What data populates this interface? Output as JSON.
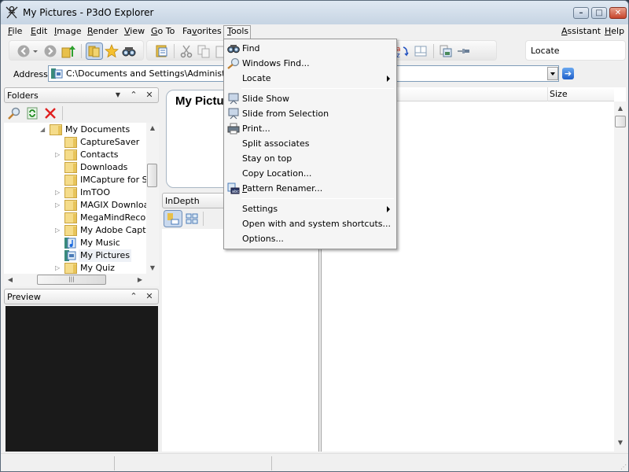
{
  "window": {
    "title": "My Pictures - P3dO Explorer",
    "controls": {
      "minimize": "–",
      "maximize": "□",
      "close": "✕"
    }
  },
  "menubar": {
    "items": [
      {
        "label": "File",
        "accel": "F",
        "rest": "ile"
      },
      {
        "label": "Edit",
        "accel": "E",
        "rest": "dit"
      },
      {
        "label": "Image",
        "accel": "I",
        "rest": "mage"
      },
      {
        "label": "Render",
        "accel": "R",
        "rest": "ender"
      },
      {
        "label": "View",
        "accel": "V",
        "rest": "iew"
      },
      {
        "label": "Go To",
        "accel": "G",
        "rest": "o To"
      },
      {
        "label": "Favorites",
        "pre": "Fa",
        "accel": "v",
        "rest": "orites"
      },
      {
        "label": "Tools",
        "accel": "T",
        "rest": "ools"
      }
    ],
    "right_items": [
      {
        "label": "Assistant",
        "accel": "A",
        "rest": "ssistant"
      },
      {
        "label": "Help",
        "accel": "H",
        "rest": "elp"
      }
    ]
  },
  "toolbar": {
    "icons": [
      "back-icon",
      "back-dropdown-icon",
      "forward-icon",
      "up-folder-icon",
      "folders-toggle-icon",
      "favorites-star-icon",
      "find-binoculars-icon",
      "folder-view-icon",
      "cut-icon",
      "copy-icon",
      "paste-icon",
      "sort-az-icon",
      "layout-icon",
      "copy-image-icon",
      "pin-icon"
    ],
    "locate_label": "Locate"
  },
  "address": {
    "label": "Address",
    "value": "C:\\Documents and Settings\\Administrator"
  },
  "folders_pane": {
    "title": "Folders",
    "tree": [
      {
        "label": "My Documents",
        "expander": "expanded",
        "icon": "folder",
        "level": 0
      },
      {
        "label": "CaptureSaver",
        "expander": "none",
        "icon": "folder",
        "level": 1
      },
      {
        "label": "Contacts",
        "expander": "collapsed",
        "icon": "folder",
        "level": 1
      },
      {
        "label": "Downloads",
        "expander": "none",
        "icon": "folder",
        "level": 1
      },
      {
        "label": "IMCapture for Sk",
        "expander": "none",
        "icon": "folder",
        "level": 1
      },
      {
        "label": "ImTOO",
        "expander": "collapsed",
        "icon": "folder",
        "level": 1
      },
      {
        "label": "MAGIX Download",
        "expander": "collapsed",
        "icon": "folder",
        "level": 1
      },
      {
        "label": "MegaMindRecord",
        "expander": "none",
        "icon": "folder",
        "level": 1
      },
      {
        "label": "My Adobe Captiv",
        "expander": "collapsed",
        "icon": "folder",
        "level": 1
      },
      {
        "label": "My Music",
        "expander": "none",
        "icon": "music",
        "level": 1
      },
      {
        "label": "My Pictures",
        "expander": "none",
        "icon": "pictures",
        "level": 1,
        "selected": true
      },
      {
        "label": "My Quiz",
        "expander": "collapsed",
        "icon": "folder",
        "level": 1
      }
    ]
  },
  "preview_pane": {
    "title": "Preview"
  },
  "info_box": {
    "title": "My Pictures"
  },
  "indepth_pane": {
    "title": "InDepth"
  },
  "file_list": {
    "columns": [
      {
        "label": ""
      },
      {
        "label": "Size"
      }
    ]
  },
  "tools_menu": {
    "items": [
      {
        "label": "Find",
        "icon": "binoculars",
        "submenu": false
      },
      {
        "label": "Windows Find...",
        "icon": "magnifier",
        "submenu": false
      },
      {
        "label": "Locate",
        "icon": null,
        "submenu": true
      },
      {
        "separator": true
      },
      {
        "label": "Slide Show",
        "icon": "projector",
        "submenu": false
      },
      {
        "label": "Slide from Selection",
        "icon": "projector",
        "submenu": false
      },
      {
        "label": "Print...",
        "icon": "printer",
        "submenu": false
      },
      {
        "label": "Split associates",
        "icon": null,
        "submenu": false
      },
      {
        "label": "Stay on top",
        "icon": null,
        "submenu": false
      },
      {
        "label": "Copy Location...",
        "icon": null,
        "submenu": false
      },
      {
        "label": "Pattern Renamer...",
        "icon": "renamer",
        "submenu": false,
        "accel": "P"
      },
      {
        "separator": true
      },
      {
        "label": "Settings",
        "icon": null,
        "submenu": true
      },
      {
        "label": "Open with and system shortcuts...",
        "icon": null,
        "submenu": false
      },
      {
        "label": "Options...",
        "icon": null,
        "submenu": false
      }
    ]
  }
}
